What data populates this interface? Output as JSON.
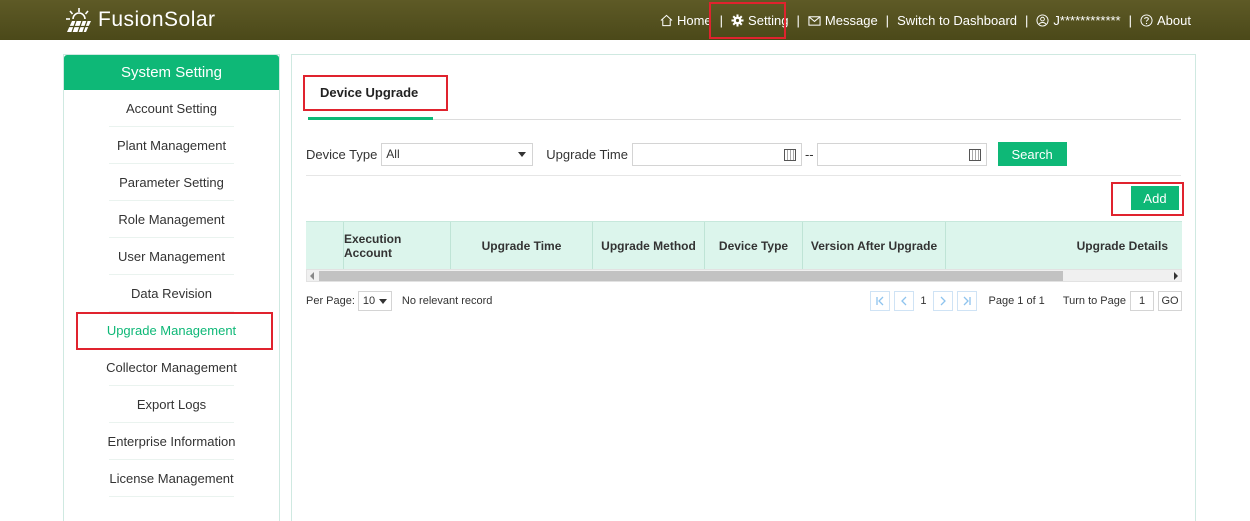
{
  "brand": {
    "name": "FusionSolar"
  },
  "nav": {
    "home": "Home",
    "setting": "Setting",
    "message": "Message",
    "dashboard": "Switch to Dashboard",
    "user": "J************",
    "about": "About",
    "separator": "|"
  },
  "sidebar": {
    "title": "System Setting",
    "items": [
      {
        "label": "Account Setting"
      },
      {
        "label": "Plant Management"
      },
      {
        "label": "Parameter Setting"
      },
      {
        "label": "Role Management"
      },
      {
        "label": "User Management"
      },
      {
        "label": "Data Revision"
      },
      {
        "label": "Upgrade Management"
      },
      {
        "label": "Collector Management"
      },
      {
        "label": "Export Logs"
      },
      {
        "label": "Enterprise Information"
      },
      {
        "label": "License Management"
      }
    ]
  },
  "main": {
    "tab": "Device Upgrade",
    "filter": {
      "device_type_label": "Device Type",
      "device_type_value": "All",
      "upgrade_time_label": "Upgrade Time",
      "range_separator": "--",
      "search": "Search"
    },
    "add": "Add",
    "table": {
      "columns": [
        "Execution Account",
        "Upgrade Time",
        "Upgrade Method",
        "Device Type",
        "Version After Upgrade",
        "Upgrade Details"
      ]
    },
    "pager": {
      "per_page_label": "Per Page:",
      "per_page_value": "10",
      "no_record": "No relevant record",
      "current_page": "1",
      "page_info": "Page 1 of 1",
      "turn_to_label": "Turn to Page",
      "turn_to_value": "1",
      "go": "GO"
    }
  },
  "colors": {
    "accent": "#0eb877",
    "header": "#57532a",
    "highlight": "#e0232e"
  }
}
